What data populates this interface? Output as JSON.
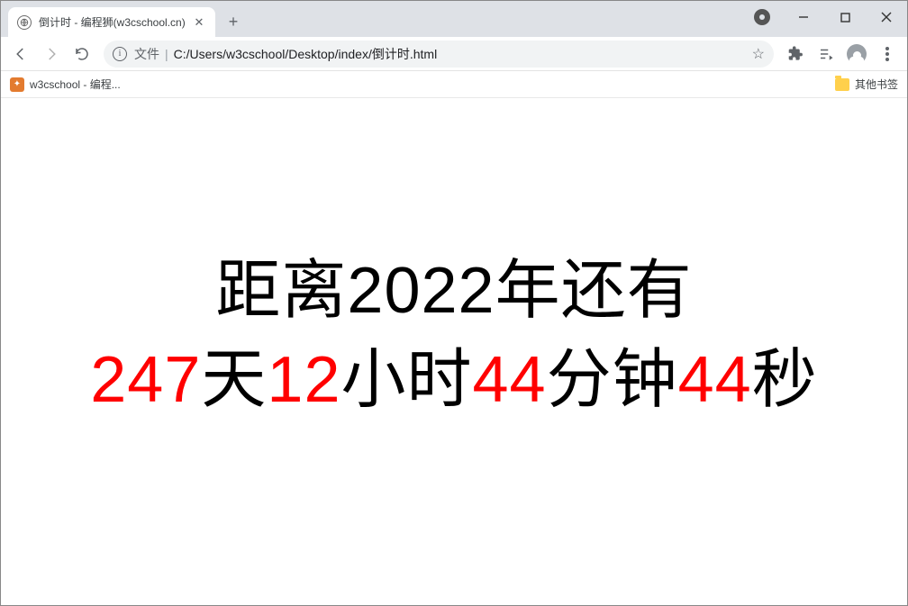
{
  "window": {
    "tab_title": "倒计时 - 编程狮(w3cschool.cn)",
    "minimize": "—",
    "maximize": "☐",
    "close": "✕"
  },
  "toolbar": {
    "file_label": "文件",
    "url": "C:/Users/w3cschool/Desktop/index/倒计时.html"
  },
  "bookmarks": {
    "item1": "w3cschool - 编程...",
    "other": "其他书签"
  },
  "countdown": {
    "headline": "距离2022年还有",
    "days": "247",
    "days_unit": "天",
    "hours": "12",
    "hours_unit": "小时",
    "minutes": "44",
    "minutes_unit": "分钟",
    "seconds": "44",
    "seconds_unit": "秒"
  }
}
